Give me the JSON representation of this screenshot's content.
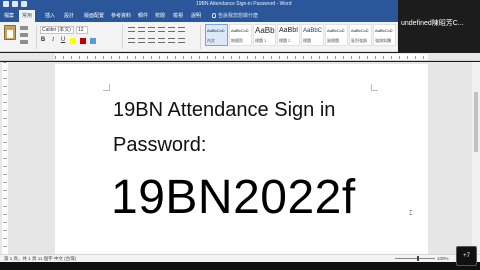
{
  "window": {
    "title": "19BN Attendance Sign-in Password - Word"
  },
  "ribbon": {
    "tabs": [
      "檔案",
      "常用",
      "插入",
      "設計",
      "版面配置",
      "參考資料",
      "郵件",
      "校閱",
      "檢視",
      "說明"
    ],
    "active_tab": "常用",
    "tell_me": "告訴我您想做什麼",
    "font_name": "Calibri (本文)",
    "font_size": "12",
    "format_buttons": [
      "B",
      "I",
      "U"
    ],
    "styles": [
      {
        "preview": "AaBbCcD",
        "name": "內文",
        "size": "normal"
      },
      {
        "preview": "AaBbCcD",
        "name": "無間距",
        "size": "normal"
      },
      {
        "preview": "AaBb",
        "name": "標題 1",
        "size": "big"
      },
      {
        "preview": "AaBbI",
        "name": "標題 2",
        "size": "mid"
      },
      {
        "preview": "AaBbC",
        "name": "標題",
        "size": "h3"
      },
      {
        "preview": "AaBbCcD",
        "name": "副標題",
        "size": "normal"
      },
      {
        "preview": "AaBbCcD",
        "name": "區別強調",
        "size": "normal"
      },
      {
        "preview": "AaBbCcD",
        "name": "強調斜體",
        "size": "normal"
      },
      {
        "preview": "AaBbCcD",
        "name": "鮮明強調",
        "size": "normal"
      }
    ]
  },
  "document": {
    "line1": "19BN Attendance Sign in",
    "line2": "Password:",
    "line3": "19BN2022f"
  },
  "status": {
    "text": "第 1 頁，共 1 頁   11 個字   中文 (台灣)",
    "zoom": "100%"
  },
  "video": {
    "caller": "undefined陳昭芳C...",
    "more": "+7"
  },
  "colors": {
    "word_blue": "#2b579a",
    "ribbon_bg": "#f3f3f3",
    "canvas_bg": "#e6e6e6"
  }
}
